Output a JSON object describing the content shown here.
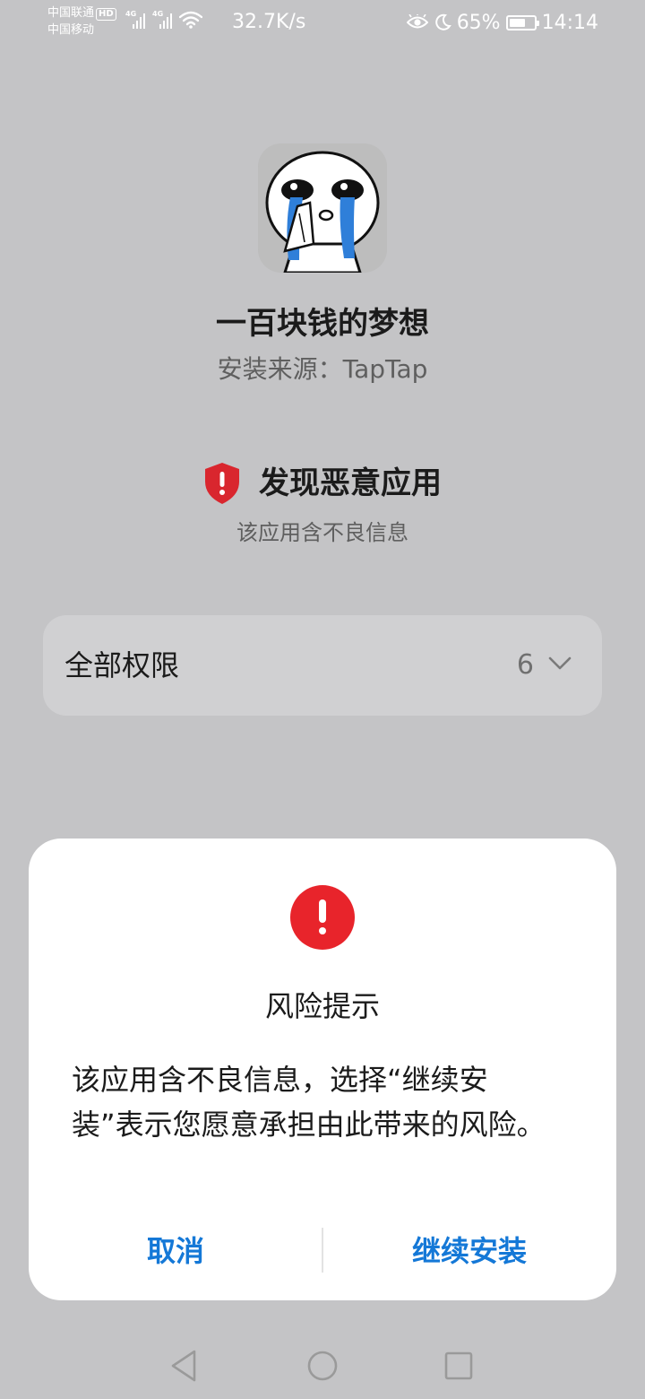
{
  "status_bar": {
    "carrier_1": "中国联通",
    "hd_badge": "HD",
    "carrier_2": "中国移动",
    "network_tag_1": "4G",
    "network_tag_2": "4G",
    "net_speed": "32.7K/s",
    "battery_percent": "65%",
    "battery_level": 0.65,
    "time": "14:14",
    "icons": [
      "eye-icon",
      "moon-icon",
      "battery-icon",
      "wifi-icon",
      "signal-icon"
    ]
  },
  "app": {
    "name": "一百块钱的梦想",
    "install_source": "安装来源：TapTap",
    "icon": "app-icon-crying-face"
  },
  "warning": {
    "title": "发现恶意应用",
    "subtitle": "该应用含不良信息",
    "color": "#d9262e"
  },
  "permissions": {
    "label": "全部权限",
    "count": "6"
  },
  "dialog": {
    "title": "风险提示",
    "message": "该应用含不良信息，选择“继续安装”表示您愿意承担由此带来的风险。",
    "cancel_label": "取消",
    "continue_label": "继续安装",
    "accent_color": "#1478d7",
    "alert_color": "#e8242b"
  },
  "nav": {
    "back": "back-icon",
    "home": "home-icon",
    "recents": "recents-icon"
  }
}
